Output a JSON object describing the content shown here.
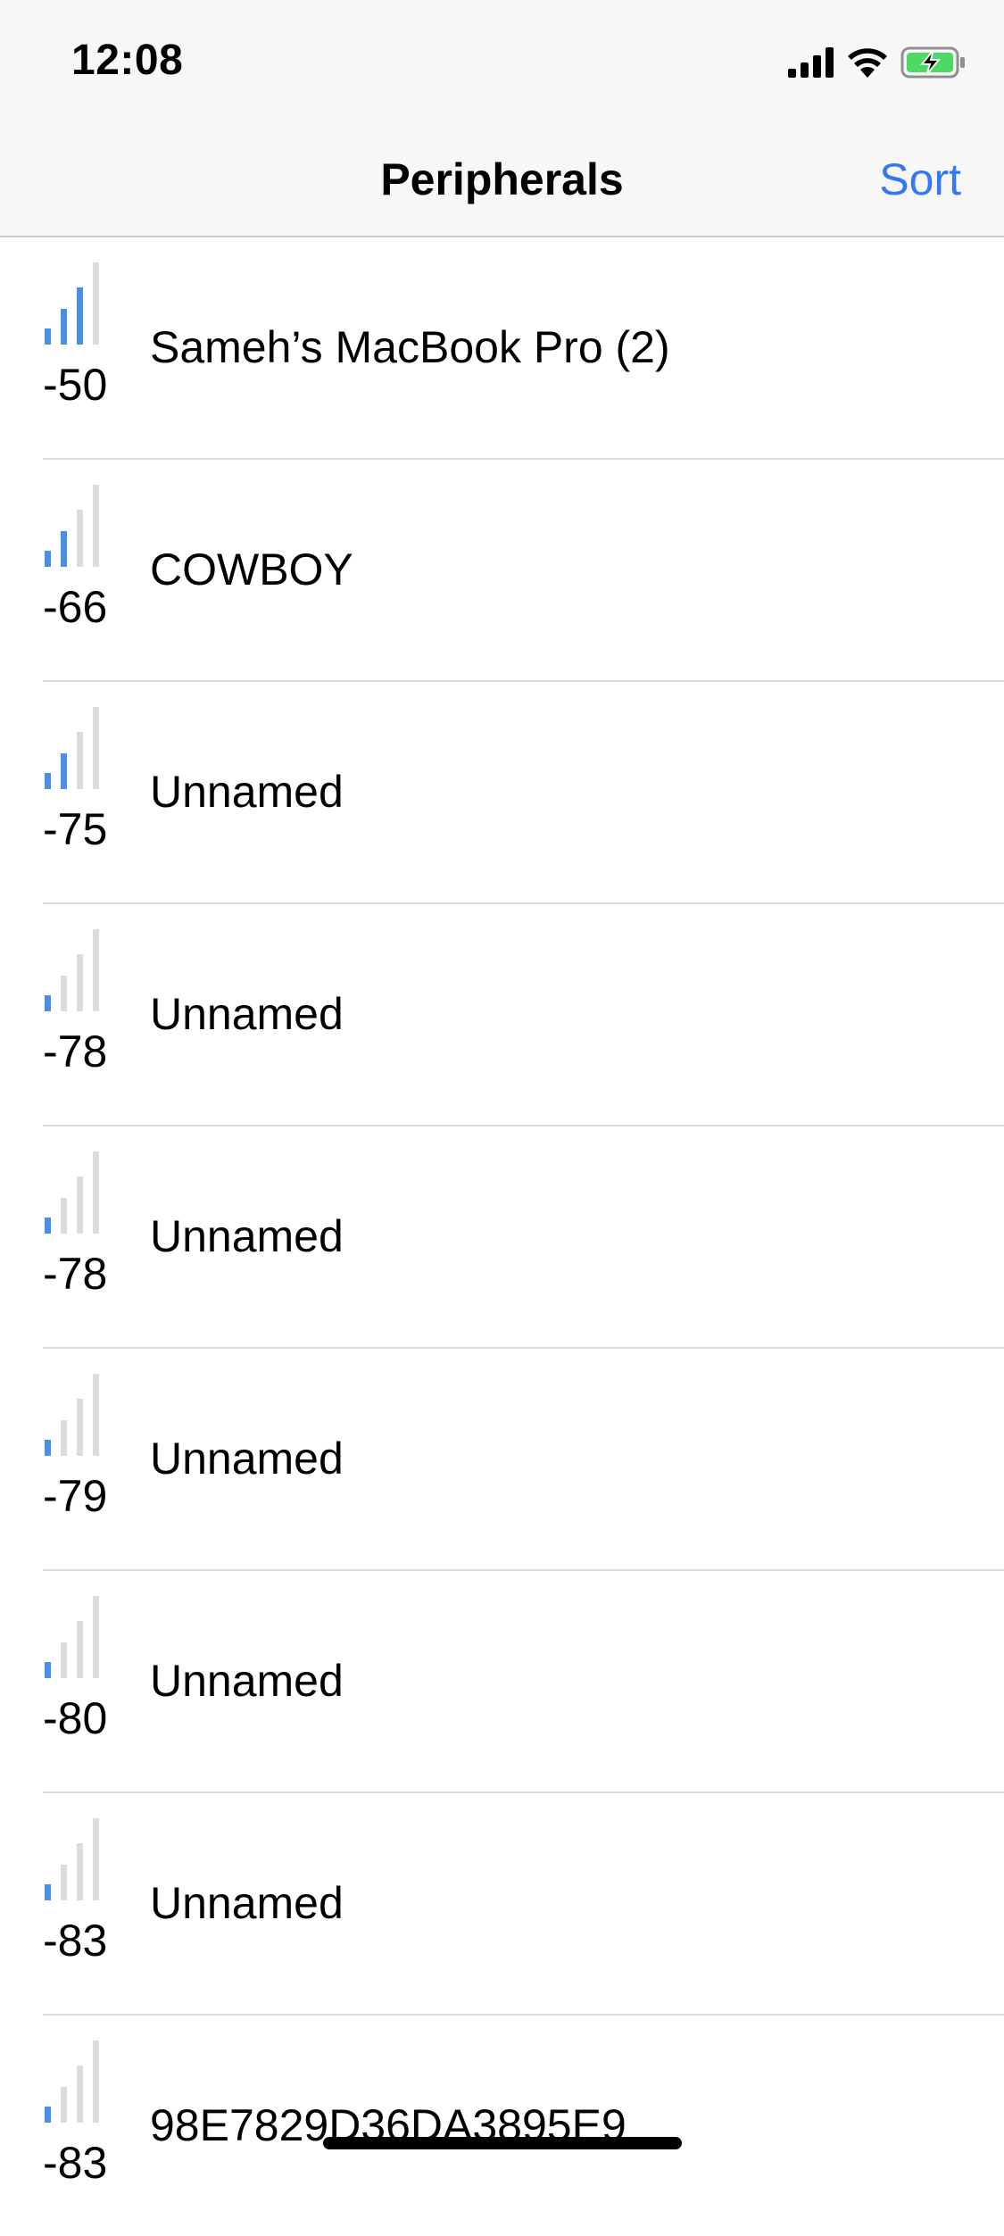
{
  "status_bar": {
    "time": "12:08",
    "icons": [
      "cellular-signal-icon",
      "wifi-icon",
      "battery-charging-icon"
    ],
    "battery_color": "#4cd964"
  },
  "nav": {
    "title": "Peripherals",
    "sort_label": "Sort"
  },
  "colors": {
    "accent": "#3478f6",
    "signal_active": "#4a90e2",
    "signal_inactive": "#dcdcdc"
  },
  "peripherals": [
    {
      "rssi": "-50",
      "name": "Sameh’s MacBook Pro (2)",
      "signal_bars": 3
    },
    {
      "rssi": "-66",
      "name": "COWBOY",
      "signal_bars": 2
    },
    {
      "rssi": "-75",
      "name": "Unnamed",
      "signal_bars": 2
    },
    {
      "rssi": "-78",
      "name": "Unnamed",
      "signal_bars": 1
    },
    {
      "rssi": "-78",
      "name": "Unnamed",
      "signal_bars": 1
    },
    {
      "rssi": "-79",
      "name": "Unnamed",
      "signal_bars": 1
    },
    {
      "rssi": "-80",
      "name": "Unnamed",
      "signal_bars": 1
    },
    {
      "rssi": "-83",
      "name": "Unnamed",
      "signal_bars": 1
    },
    {
      "rssi": "-83",
      "name": "98E7829D36DA3895E9",
      "signal_bars": 1
    }
  ]
}
